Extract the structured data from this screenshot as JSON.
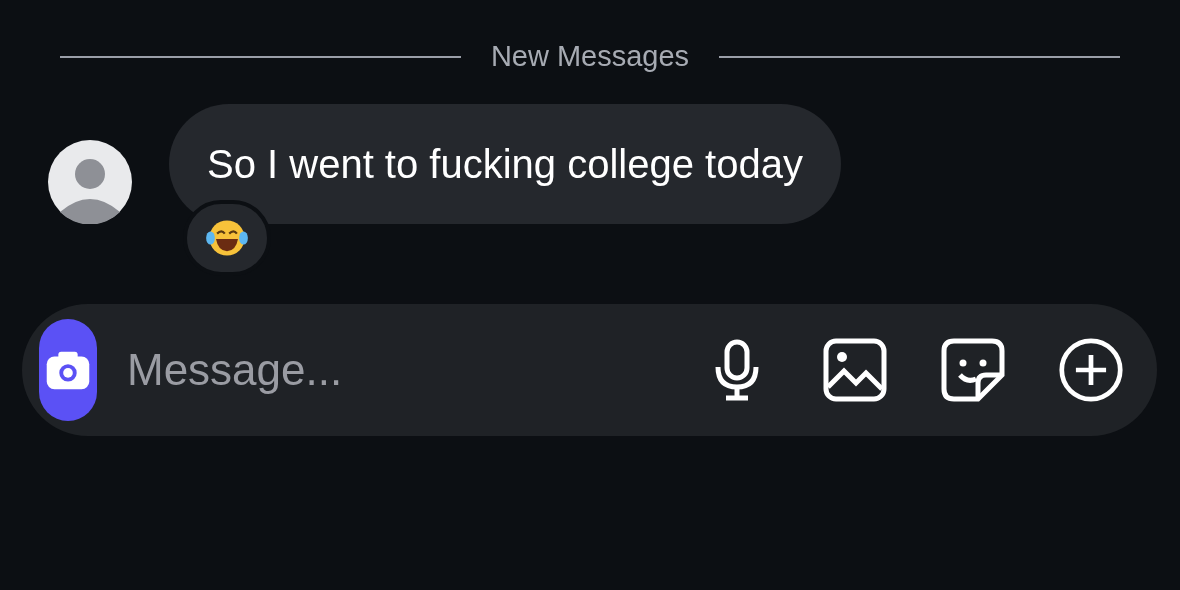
{
  "divider": {
    "label": "New Messages"
  },
  "messages": [
    {
      "text": "So I went to fucking college today"
    }
  ],
  "composer": {
    "placeholder": "Message..."
  }
}
